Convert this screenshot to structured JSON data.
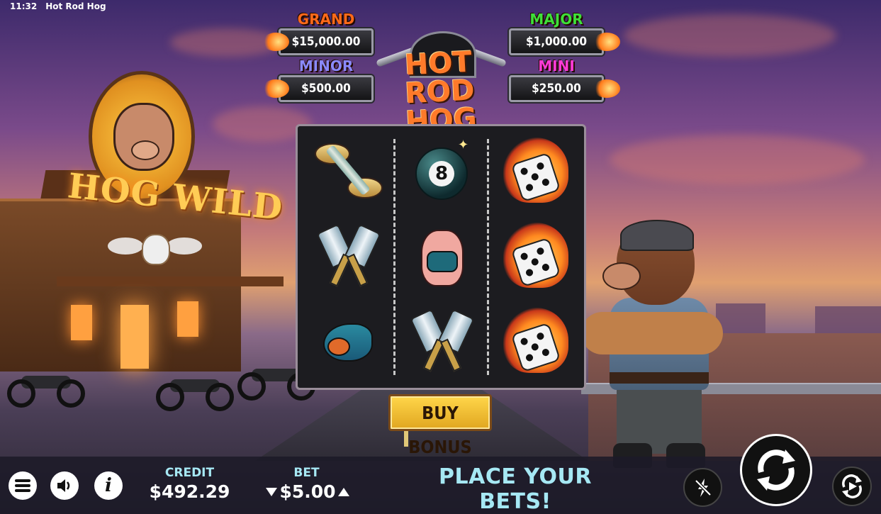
{
  "status_bar": {
    "time": "11:32",
    "title": "Hot Rod Hog"
  },
  "jackpots": [
    {
      "name": "GRAND",
      "value": "$15,000.00",
      "color": "#ff6a1a"
    },
    {
      "name": "MAJOR",
      "value": "$1,000.00",
      "color": "#3ee03a"
    },
    {
      "name": "MINOR",
      "value": "$500.00",
      "color": "#8a8aff"
    },
    {
      "name": "MINI",
      "value": "$250.00",
      "color": "#ff3ad8"
    }
  ],
  "logo": {
    "line1": "HOT ROD",
    "line2": "HOG"
  },
  "scenery": {
    "sign_text": "HOG WILD"
  },
  "reels": [
    [
      "winged-spark-plug",
      "crossed-pistons",
      "swallow"
    ],
    [
      "eight-ball",
      "pinup-pig",
      "crossed-pistons"
    ],
    [
      "flaming-dice",
      "flaming-dice",
      "flaming-dice"
    ]
  ],
  "buy_bonus": {
    "label": "BUY BONUS"
  },
  "bottom_bar": {
    "credit_label": "CREDIT",
    "credit_value": "$492.29",
    "bet_label": "BET",
    "bet_value": "$5.00",
    "message": "PLACE YOUR BETS!"
  },
  "icons": {
    "menu": "hamburger-menu-icon",
    "sound": "speaker-icon",
    "info": "info-icon",
    "turbo": "lightning-off-icon",
    "spin": "spin-arrows-icon",
    "autoplay": "autoplay-icon"
  },
  "colors": {
    "accent_text": "#a6e8f4",
    "buy_bonus": "#ffd64a",
    "bottom_bar": "#1c1a28"
  }
}
